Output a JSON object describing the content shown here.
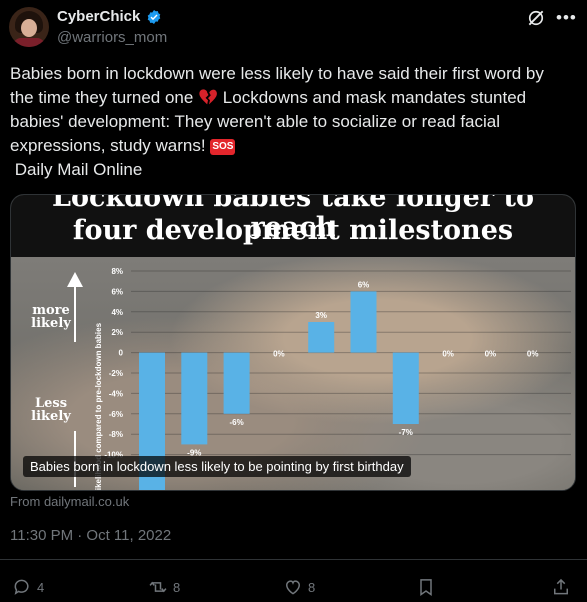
{
  "author": {
    "name": "CyberChick",
    "handle": "@warriors_mom"
  },
  "tweet": {
    "text_part1": "Babies born in lockdown were less likely to have said their first word by the time they turned one ",
    "text_part2": " Lockdowns and mask mandates stunted babies' development: They weren't able to socialize or read facial expressions, study warns! ",
    "sos_label": "SOS",
    "text_part3": "Daily Mail Online"
  },
  "card": {
    "headline_line1": "Lockdown babies take longer to reach",
    "headline_line2": "four development milestones",
    "caption": "Babies born in lockdown less likely to be pointing by first birthday",
    "side_label_top": "more likely",
    "side_label_bottom": "Less likely",
    "axis_label": "Likelihood compared to pre-lockdown babies",
    "source": "From dailymail.co.uk"
  },
  "chart_data": {
    "type": "bar",
    "title": "Lockdown babies take longer to reach four development milestones",
    "ylabel": "Likelihood compared to pre-lockdown babies",
    "yticks": [
      "8%",
      "6%",
      "4%",
      "2%",
      "0",
      "-2%",
      "-4%",
      "-6%",
      "-8%",
      "-10%"
    ],
    "ylim": [
      -10,
      8
    ],
    "bar_color": "#59b2e6",
    "values": [
      -14,
      -9,
      -6,
      0,
      3,
      6,
      -7,
      0,
      0,
      0
    ],
    "value_labels": [
      "",
      "-9%",
      "-6%",
      "0%",
      "3%",
      "6%",
      "-7%",
      "0%",
      "0%",
      "0%"
    ]
  },
  "meta": {
    "timestamp": "11:30 PM · Oct 11, 2022"
  },
  "actions": {
    "replies": "4",
    "retweets": "8",
    "likes": "8"
  },
  "colors": {
    "verified": "#1d9bf0",
    "secondary_text": "#71767b",
    "sos": "#e3262c",
    "heart_emoji": "#d6222a"
  }
}
